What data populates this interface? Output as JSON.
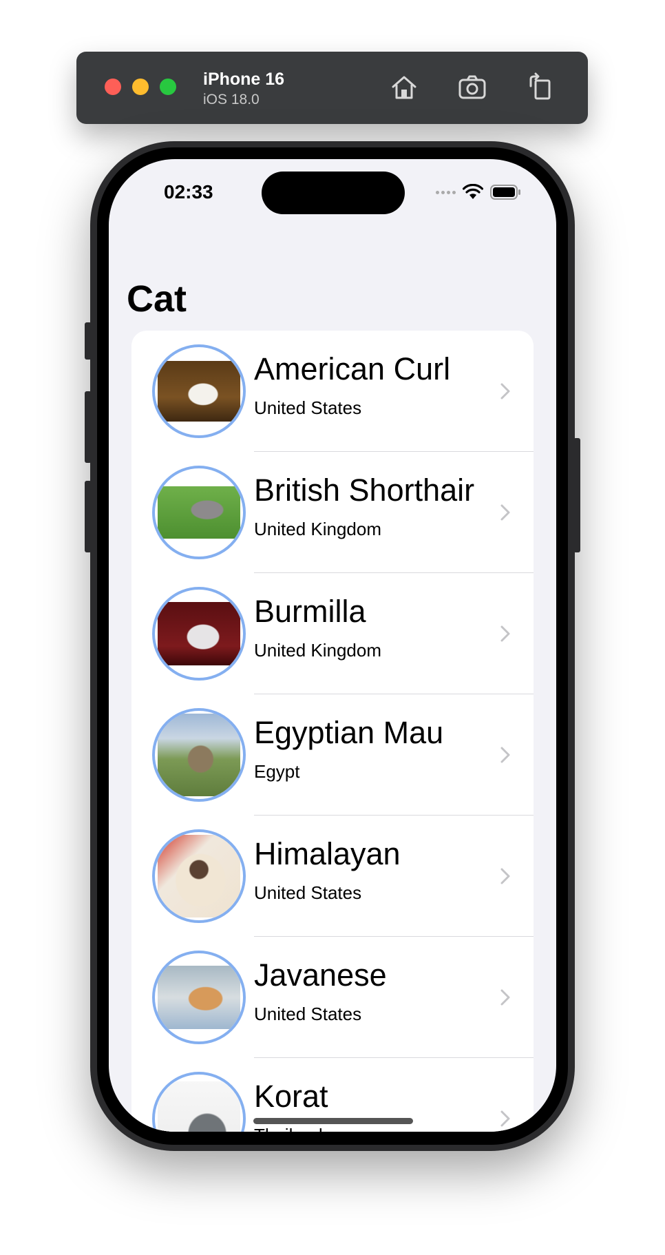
{
  "simulator": {
    "device_name": "iPhone 16",
    "os_version": "iOS 18.0",
    "toolbar_icons": [
      "home-icon",
      "screenshot-icon",
      "rotate-icon"
    ]
  },
  "status_bar": {
    "time": "02:33",
    "icons": [
      "signal-dots-icon",
      "wifi-icon",
      "battery-icon"
    ]
  },
  "nav": {
    "title": "Cat"
  },
  "cats": [
    {
      "name": "American Curl",
      "origin": "United States"
    },
    {
      "name": "British Shorthair",
      "origin": "United Kingdom"
    },
    {
      "name": "Burmilla",
      "origin": "United Kingdom"
    },
    {
      "name": "Egyptian Mau",
      "origin": "Egypt"
    },
    {
      "name": "Himalayan",
      "origin": "United States"
    },
    {
      "name": "Javanese",
      "origin": "United States"
    },
    {
      "name": "Korat",
      "origin": "Thailand"
    }
  ],
  "colors": {
    "avatar_ring": "#84aff0",
    "background": "#f2f2f7",
    "chevron": "#c4c4c7"
  }
}
